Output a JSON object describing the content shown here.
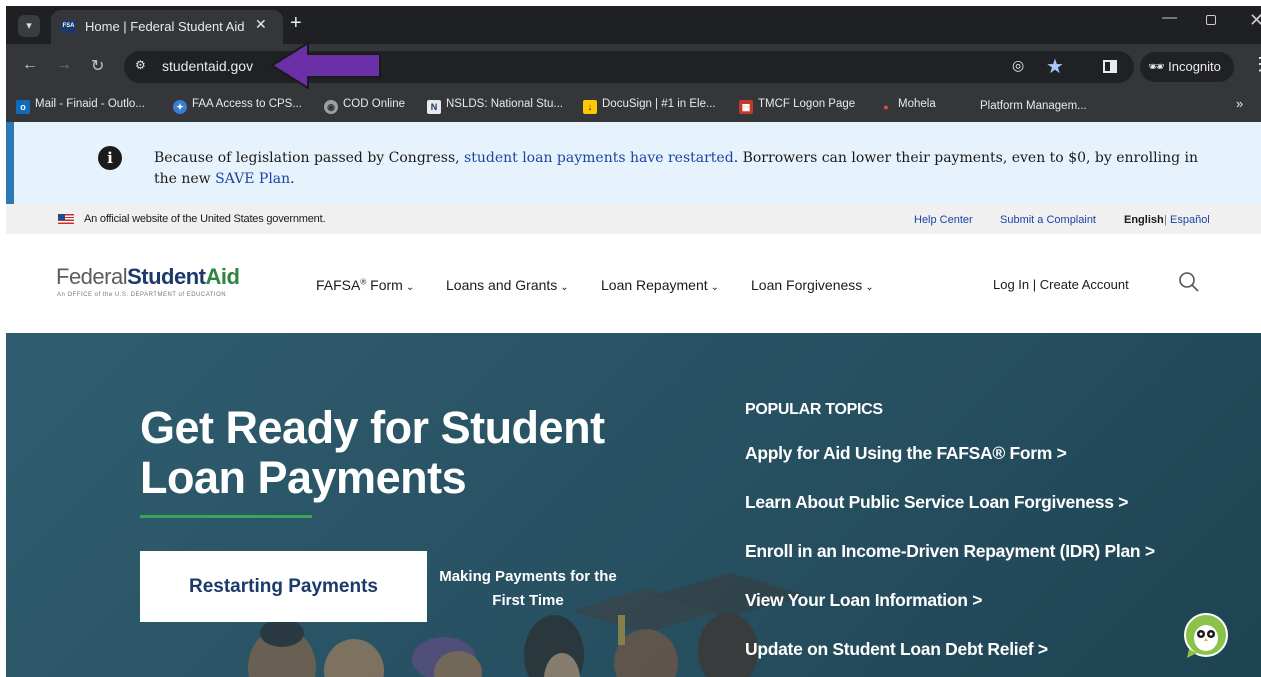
{
  "browser": {
    "tab_title": "Home | Federal Student Aid",
    "tab_favicon_text": "FSA",
    "url": "studentaid.gov",
    "profile": "Incognito",
    "bookmarks": [
      {
        "label": "Mail - Finaid - Outlo...",
        "icon": "outlook-icon",
        "color": "#0f6cbd"
      },
      {
        "label": "FAA Access to CPS...",
        "icon": "globe-icon",
        "color": "#3c7bd6"
      },
      {
        "label": "COD Online",
        "icon": "web-icon",
        "color": "#9aa0a6"
      },
      {
        "label": "NSLDS: National Stu...",
        "icon": "nslds-icon",
        "color": "#e8eaed"
      },
      {
        "label": "DocuSign | #1 in Ele...",
        "icon": "docusign-icon",
        "color": "#ffc800"
      },
      {
        "label": "TMCF Logon Page",
        "icon": "tmcf-icon",
        "color": "#c0392b"
      },
      {
        "label": "Mohela",
        "icon": "mohela-icon",
        "color": "#e74c3c"
      },
      {
        "label": "Platform Managem...",
        "icon": "platform-icon",
        "color": "#35363a"
      }
    ]
  },
  "alert": {
    "text_before": "Because of legislation passed by Congress, ",
    "link1": "student loan payments have restarted",
    "text_middle": ". Borrowers can lower their payments, even to $0, by enrolling in the new ",
    "link2": "SAVE Plan",
    "text_after": "."
  },
  "govbar": {
    "text": "An official website of the United States government.",
    "help": "Help Center",
    "complaint": "Submit a Complaint",
    "english": "English",
    "separator": "|",
    "spanish": "Español"
  },
  "header": {
    "logo_federal": "Federal",
    "logo_student": "Student",
    "logo_aid": "Aid",
    "logo_sub": "An OFFICE of the U.S. DEPARTMENT of EDUCATION",
    "nav": {
      "fafsa": "FAFSA",
      "fafsa_mark": "®",
      "fafsa_rest": " Form",
      "loans": "Loans and Grants",
      "repayment": "Loan Repayment",
      "forgiveness": "Loan Forgiveness"
    },
    "login": "Log In",
    "separator": "|",
    "create": "Create Account"
  },
  "hero": {
    "title": "Get Ready for Student Loan Payments",
    "button": "Restarting Payments",
    "secondary": "Making Payments for the First Time",
    "popular_heading": "POPULAR TOPICS",
    "topics": [
      "Apply for Aid Using the FAFSA® Form >",
      "Learn About Public Service Loan Forgiveness >",
      "Enroll in an Income-Driven Repayment (IDR) Plan >",
      "View Your Loan Information >",
      "Update on Student Loan Debt Relief >"
    ]
  },
  "colors": {
    "chrome_dark": "#1f2023",
    "chrome": "#35363a",
    "alert_bg": "#e7f3fc",
    "brand_navy": "#1b3a6b",
    "brand_green": "#2e8540",
    "hero_teal": "#2a5566",
    "annotation_arrow": "#6b2fa8"
  }
}
